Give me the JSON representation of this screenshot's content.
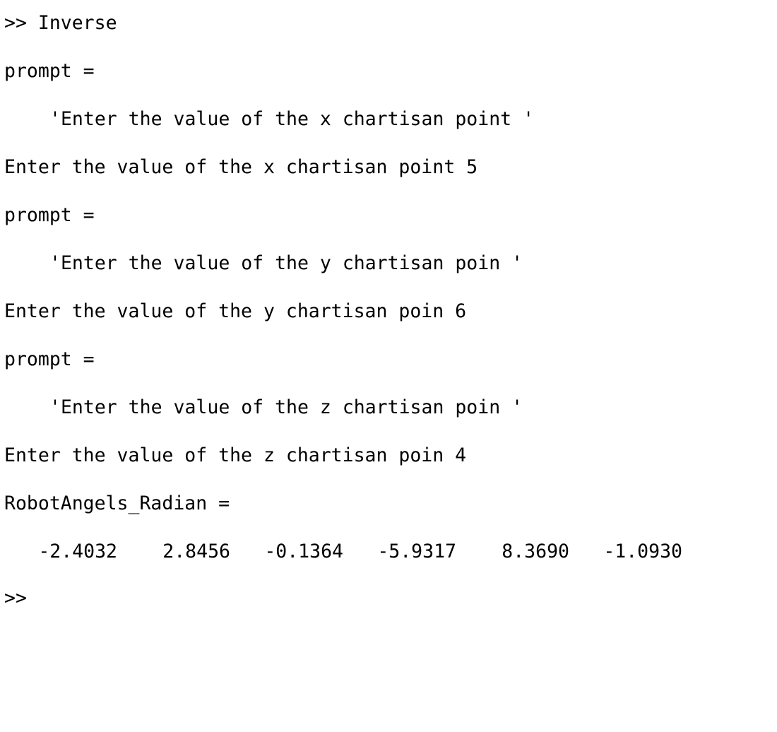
{
  "console": {
    "command_line": ">> Inverse",
    "blocks": [
      {
        "var_header": "prompt =",
        "string_value": "'Enter the value of the x chartisan point '",
        "input_line": "Enter the value of the x chartisan point 5"
      },
      {
        "var_header": "prompt =",
        "string_value": "'Enter the value of the y chartisan poin '",
        "input_line": "Enter the value of the y chartisan poin 6"
      },
      {
        "var_header": "prompt =",
        "string_value": "'Enter the value of the z chartisan poin '",
        "input_line": "Enter the value of the z chartisan poin 4"
      }
    ],
    "result_header": "RobotAngels_Radian =",
    "result_values": [
      "-2.4032",
      "2.8456",
      "-0.1364",
      "-5.9317",
      "8.3690",
      "-1.0930"
    ],
    "trailing_prompt": ">>"
  }
}
